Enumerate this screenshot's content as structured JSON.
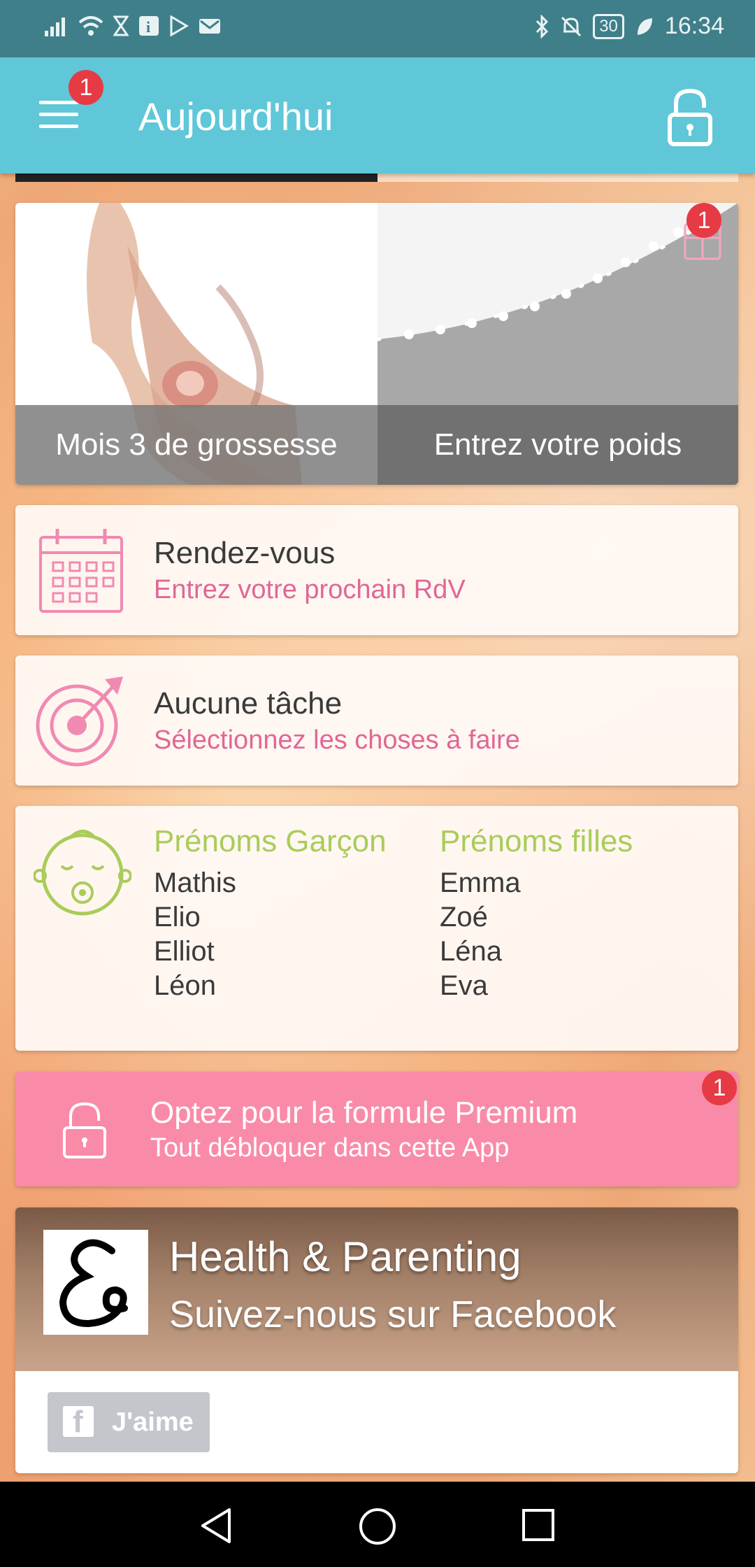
{
  "status_bar": {
    "battery": "30",
    "time": "16:34"
  },
  "app_bar": {
    "title": "Aujourd'hui",
    "menu_badge": "1"
  },
  "hero": {
    "left_caption": "Mois 3 de grossesse",
    "right_caption": "Entrez votre poids",
    "badge": "1"
  },
  "appointments": {
    "title": "Rendez-vous",
    "subtitle": "Entrez votre prochain RdV"
  },
  "tasks": {
    "title": "Aucune tâche",
    "subtitle": "Sélectionnez les choses à faire"
  },
  "names": {
    "boys_heading": "Prénoms Garçon",
    "girls_heading": "Prénoms filles",
    "boys": [
      "Mathis",
      "Elio",
      "Elliot",
      "Léon"
    ],
    "girls": [
      "Emma",
      "Zoé",
      "Léna",
      "Eva"
    ]
  },
  "premium": {
    "title": "Optez pour la formule Premium",
    "subtitle": "Tout débloquer dans cette App",
    "badge": "1"
  },
  "facebook": {
    "title": "Health & Parenting",
    "subtitle": "Suivez-nous sur Facebook",
    "like_label": "J'aime"
  },
  "colors": {
    "app_bar": "#5fc7d8",
    "status_bar": "#3f7f8a",
    "pink": "#e06796",
    "green": "#a9cc5a",
    "premium": "#f98ba9",
    "badge": "#e63a45"
  }
}
